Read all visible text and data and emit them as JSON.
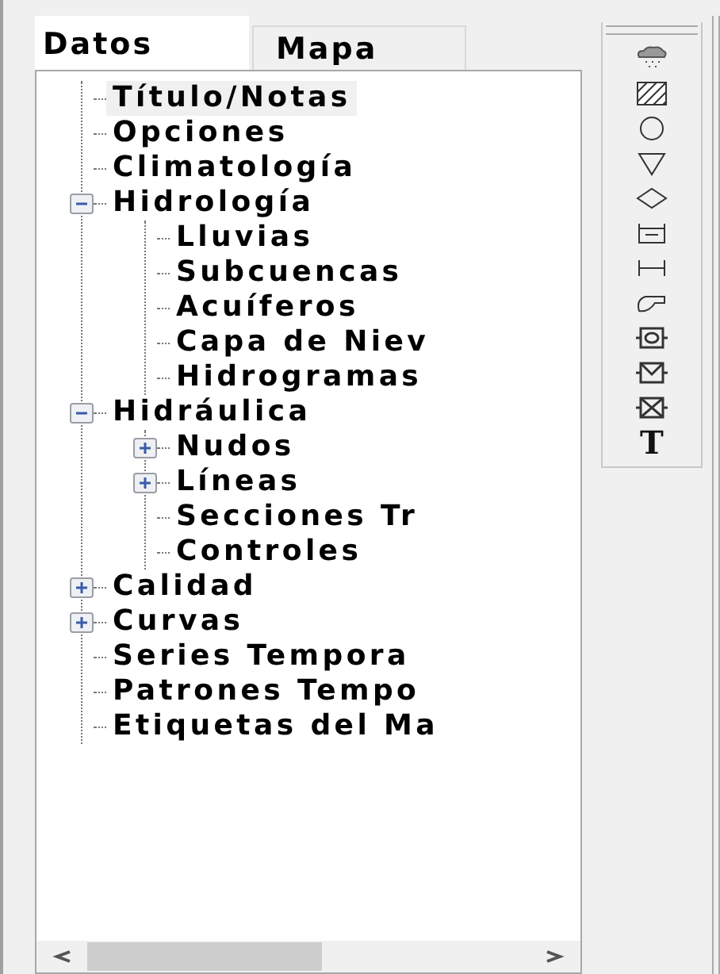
{
  "tabs": [
    {
      "label": "Datos",
      "selected": true
    },
    {
      "label": "Mapa",
      "selected": false
    }
  ],
  "tree": [
    {
      "label": "Título/Notas",
      "selected": true
    },
    {
      "label": "Opciones",
      "selected": false
    },
    {
      "label": "Climatología",
      "selected": false
    },
    {
      "label": "Hidrología",
      "selected": false,
      "expanded": true,
      "children": [
        {
          "label": "Lluvias",
          "selected": false
        },
        {
          "label": "Subcuencas",
          "selected": false
        },
        {
          "label": "Acuíferos",
          "selected": false
        },
        {
          "label": "Capa de Niev",
          "selected": false
        },
        {
          "label": "Hidrogramas",
          "selected": false
        }
      ]
    },
    {
      "label": "Hidráulica",
      "selected": false,
      "expanded": true,
      "children": [
        {
          "label": "Nudos",
          "selected": false,
          "expanded": false
        },
        {
          "label": "Líneas",
          "selected": false,
          "expanded": false
        },
        {
          "label": "Secciones Tr",
          "selected": false
        },
        {
          "label": "Controles",
          "selected": false
        }
      ]
    },
    {
      "label": "Calidad",
      "selected": false,
      "expanded": false
    },
    {
      "label": "Curvas",
      "selected": false,
      "expanded": false
    },
    {
      "label": "Series Tempora",
      "selected": false
    },
    {
      "label": "Patrones Tempo",
      "selected": false
    },
    {
      "label": "Etiquetas del Ma",
      "selected": false
    }
  ],
  "toolbar": [
    {
      "kind": "rain"
    },
    {
      "kind": "hatch"
    },
    {
      "kind": "circle"
    },
    {
      "kind": "triangle"
    },
    {
      "kind": "diamond"
    },
    {
      "kind": "storage"
    },
    {
      "kind": "conduit"
    },
    {
      "kind": "pump"
    },
    {
      "kind": "orifice"
    },
    {
      "kind": "weir"
    },
    {
      "kind": "outlet"
    },
    {
      "kind": "text",
      "label": "T"
    }
  ]
}
